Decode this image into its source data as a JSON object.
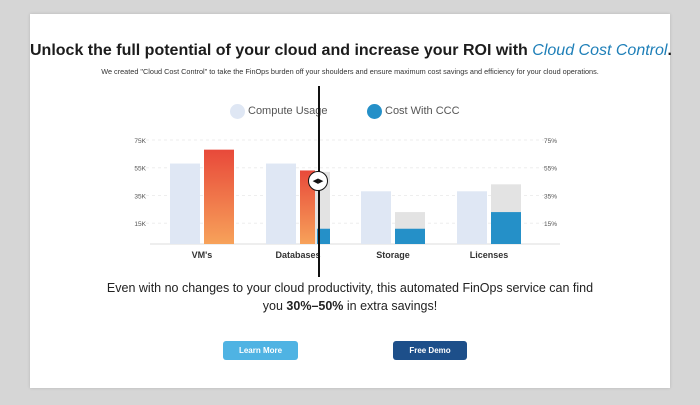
{
  "header": {
    "headline_main": "Unlock the full potential of your cloud and increase your ROI with",
    "headline_accent": "Cloud Cost Control",
    "headline_end": ".",
    "subtitle": "We created \"Cloud Cost Control\" to take the FinOps burden off your shoulders and ensure maximum cost savings and efficiency for your cloud operations."
  },
  "legend": {
    "compute_label": "Compute Usage",
    "ccc_label": "Cost With CCC"
  },
  "colors": {
    "compute": "#dfe7f4",
    "ccc": "#2590c8",
    "orange_top": "#e8493a",
    "orange_bottom": "#f7a25a",
    "gray_overlay": "#e3e3e3",
    "accent": "#1e7fb8"
  },
  "chart_data": {
    "type": "bar",
    "categories": [
      "VM's",
      "Databases",
      "Storage",
      "Licenses"
    ],
    "left_ticks": [
      "75K",
      "55K",
      "35K",
      "15K"
    ],
    "right_ticks": [
      "75%",
      "55%",
      "35%",
      "15%"
    ],
    "ylim": [
      0,
      80
    ],
    "series": [
      {
        "name": "Compute Usage",
        "values": [
          58,
          58,
          38,
          38
        ]
      },
      {
        "name": "Cost With CCC",
        "values": [
          68,
          53,
          11,
          23
        ]
      }
    ],
    "gray_overlay": [
      0,
      52,
      23,
      43
    ],
    "grid": true
  },
  "body_text": {
    "line1": "Even with no changes to your cloud productivity, this automated FinOps service can find",
    "line2_pre": "you ",
    "line2_highlight": "30%–50%",
    "line2_post": " in extra savings!"
  },
  "buttons": {
    "learn_more": "Learn More",
    "free_demo": "Free Demo"
  },
  "slider": {
    "handle_icon": "drag-arrows-icon",
    "handle_glyph": "◀▶"
  }
}
